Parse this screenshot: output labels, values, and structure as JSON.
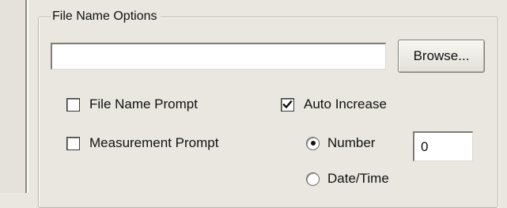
{
  "group": {
    "title": "File Name Options"
  },
  "file_path": {
    "value": "",
    "placeholder": ""
  },
  "browse_button": {
    "label": "Browse..."
  },
  "options": {
    "file_name_prompt": {
      "label": "File Name Prompt",
      "checked": false
    },
    "measurement_prompt": {
      "label": "Measurement Prompt",
      "checked": false
    },
    "auto_increase": {
      "label": "Auto Increase",
      "checked": true
    }
  },
  "increase_mode": {
    "number": {
      "label": "Number",
      "selected": true
    },
    "datetime": {
      "label": "Date/Time",
      "selected": false
    }
  },
  "number_field": {
    "value": "0"
  }
}
